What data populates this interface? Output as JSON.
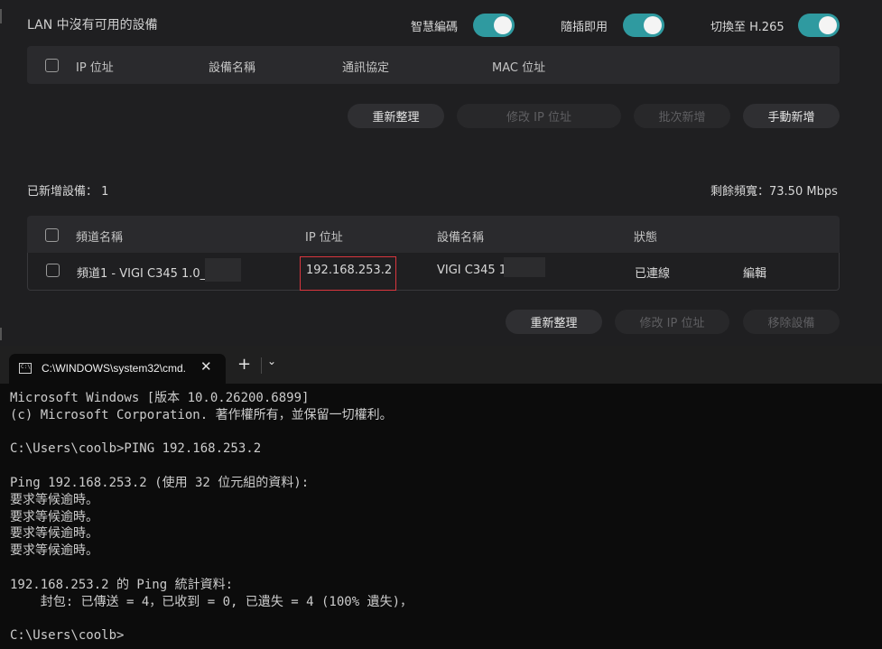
{
  "device_panel": {
    "lan_message": "LAN 中沒有可用的設備",
    "toggles": [
      {
        "label": "智慧編碼",
        "on": true
      },
      {
        "label": "隨插即用",
        "on": true
      },
      {
        "label": "切換至 H.265",
        "on": true
      }
    ],
    "lan_table_headers": [
      "IP 位址",
      "設備名稱",
      "通訊協定",
      "MAC 位址"
    ],
    "lan_buttons": [
      {
        "label": "重新整理",
        "enabled": true
      },
      {
        "label": "修改 IP 位址",
        "enabled": false
      },
      {
        "label": "批次新增",
        "enabled": false
      },
      {
        "label": "手動新增",
        "enabled": true
      }
    ],
    "added_label": "已新增設備： 1",
    "bandwidth": "剩餘頻寬：73.50 Mbps",
    "added_table_headers": [
      "頻道名稱",
      "IP 位址",
      "設備名稱",
      "狀態"
    ],
    "added_rows": [
      {
        "channel": "頻道1 - VIGI C345 1.0_",
        "ip": "192.168.253.2",
        "device": "VIGI C345 1",
        "status": "已連線",
        "action": "編輯"
      }
    ],
    "added_buttons": [
      {
        "label": "重新整理",
        "enabled": true
      },
      {
        "label": "修改 IP 位址",
        "enabled": false
      },
      {
        "label": "移除設備",
        "enabled": false
      }
    ],
    "colors": {
      "toggle_on": "#2f9aa0",
      "highlight": "#d9363e"
    }
  },
  "terminal": {
    "tab_title": "C:\\WINDOWS\\system32\\cmd.",
    "new_tab_icon": "plus-icon",
    "dropdown_icon": "chevron-down-icon",
    "lines": [
      "Microsoft Windows [版本 10.0.26200.6899]",
      "(c) Microsoft Corporation. 著作權所有，並保留一切權利。",
      "",
      "C:\\Users\\coolb>PING 192.168.253.2",
      "",
      "Ping 192.168.253.2 (使用 32 位元組的資料):",
      "要求等候逾時。",
      "要求等候逾時。",
      "要求等候逾時。",
      "要求等候逾時。",
      "",
      "192.168.253.2 的 Ping 統計資料:",
      "    封包: 已傳送 = 4，已收到 = 0, 已遺失 = 4 (100% 遺失)，",
      "",
      "C:\\Users\\coolb>"
    ]
  }
}
